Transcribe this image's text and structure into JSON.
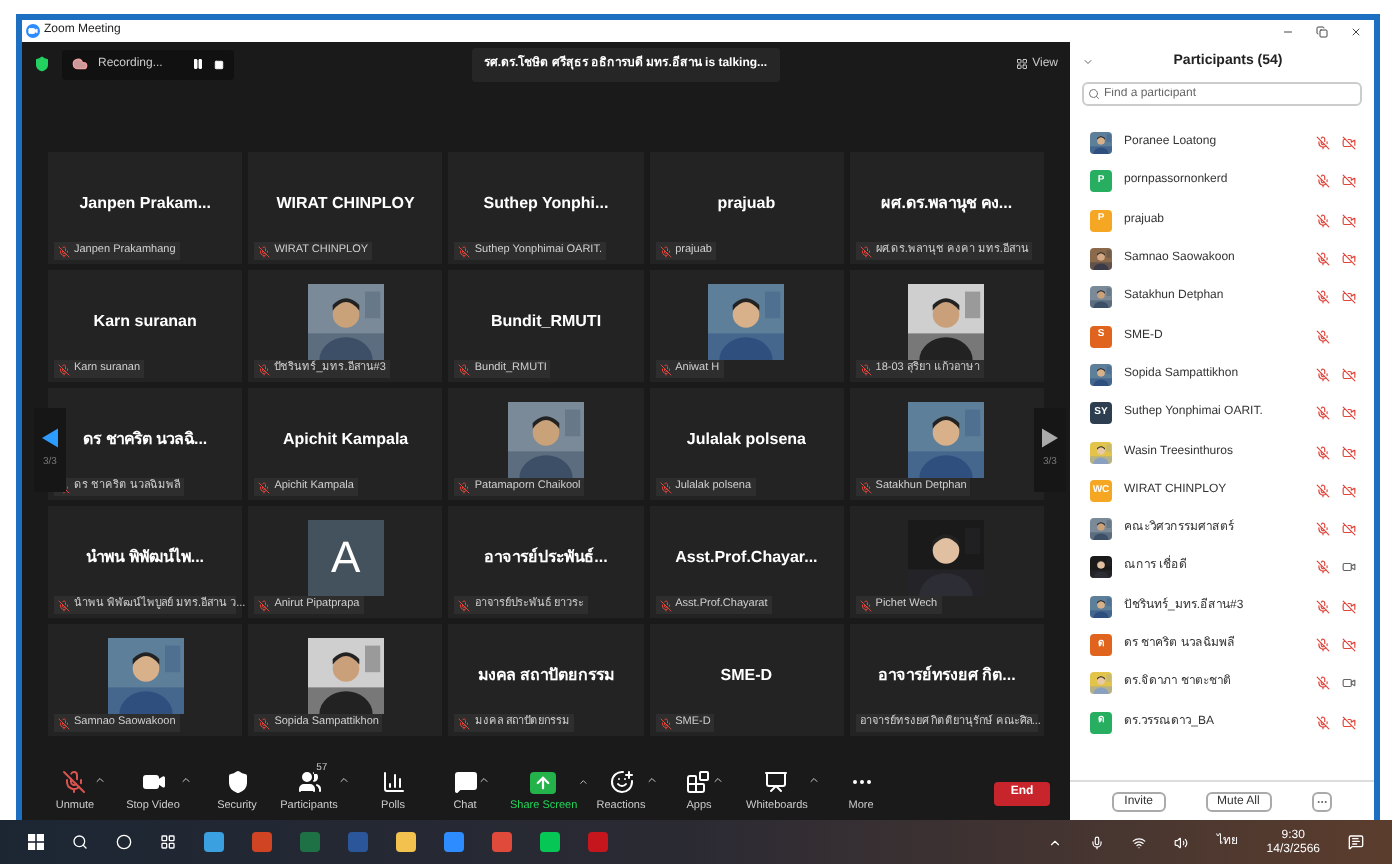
{
  "window": {
    "title": "Zoom Meeting"
  },
  "meeting": {
    "recording": "Recording...",
    "talking": "รศ.ดร.โชษิต ศรีสุธร อธิการบดี มทร.อีสาน is  talking...",
    "view": "View",
    "page_left": "3/3",
    "page_right": "3/3",
    "tiles": [
      {
        "kind": "name",
        "title": "Janpen  Prakam...",
        "label": "Janpen Prakamhang",
        "muted": true
      },
      {
        "kind": "name",
        "title": "WIRAT CHINPLOY",
        "label": "WIRAT CHINPLOY",
        "muted": true
      },
      {
        "kind": "name",
        "title": "Suthep  Yonphi...",
        "label": "Suthep Yonphimai OARIT.",
        "muted": true
      },
      {
        "kind": "name",
        "title": "prajuab",
        "label": "prajuab",
        "muted": true
      },
      {
        "kind": "name",
        "title": "ผศ.ดร.พลานุช คง...",
        "label": "ผศ.ดร.พลานุช คงคา มทร.อีสาน",
        "muted": true
      },
      {
        "kind": "name",
        "title": "Karn suranan",
        "label": "Karn suranan",
        "muted": true
      },
      {
        "kind": "picture",
        "label": "ปัชรินทร์_มทร.อีสาน#3",
        "muted": true
      },
      {
        "kind": "name",
        "title": "Bundit_RMUTI",
        "label": "Bundit_RMUTI",
        "muted": true
      },
      {
        "kind": "picture",
        "label": "Aniwat H",
        "muted": true
      },
      {
        "kind": "picture",
        "label": "18-03 สุริยา แก้วอาษา",
        "muted": true
      },
      {
        "kind": "name",
        "title": "ดร ชาคริต นวลฉิ...",
        "label": "ดร ชาคริต นวลฉิมพลี",
        "muted": true
      },
      {
        "kind": "name",
        "title": "Apichit Kampala",
        "label": "Apichit Kampala",
        "muted": true
      },
      {
        "kind": "picture",
        "label": "Patamaporn Chaikool",
        "muted": true
      },
      {
        "kind": "name",
        "title": "Julalak polsena",
        "label": "Julalak polsena",
        "muted": true
      },
      {
        "kind": "picture",
        "label": "Satakhun Detphan",
        "muted": true
      },
      {
        "kind": "name",
        "title": "นำพน พิพัฒน์ไพ...",
        "label": "นำพน พิพัฒน์ไพบูลย์ มทร.อีสาน ว...",
        "muted": true
      },
      {
        "kind": "avatar",
        "title": "A",
        "label": "Anirut Pipatprapa",
        "muted": true
      },
      {
        "kind": "name",
        "title": "อาจารย์ประพันธ์...",
        "label": "อาจารย์ประพันธ์ ยาวระ",
        "muted": true
      },
      {
        "kind": "name",
        "title": "Asst.Prof.Chayar...",
        "label": "Asst.Prof.Chayarat",
        "muted": true
      },
      {
        "kind": "picture",
        "label": "Pichet Wech",
        "muted": true
      },
      {
        "kind": "picture",
        "label": "Samnao Saowakoon",
        "muted": true
      },
      {
        "kind": "picture",
        "label": "Sopida Sampattikhon",
        "muted": true
      },
      {
        "kind": "name",
        "title": "มงคล สถาปัตยกรรม",
        "label": "มงคล สถาปัตยกรรม",
        "muted": true
      },
      {
        "kind": "name",
        "title": "SME-D",
        "label": "SME-D",
        "muted": true
      },
      {
        "kind": "name",
        "title": "อาจารย์ทรงยศ กิต...",
        "label": "อาจารย์ทรงยศ กิตติยานุรักษ์ คณะศิล...",
        "muted": false
      }
    ]
  },
  "toolbar": [
    {
      "kind": "unmute",
      "label": "Unmute",
      "caret": true
    },
    {
      "kind": "video",
      "label": "Stop Video",
      "caret": true
    },
    {
      "kind": "security",
      "label": "Security",
      "caret": false
    },
    {
      "kind": "participants",
      "label": "Participants",
      "badge": "57",
      "caret": true
    },
    {
      "kind": "polls",
      "label": "Polls",
      "caret": false
    },
    {
      "kind": "chat",
      "label": "Chat",
      "caret": true
    },
    {
      "kind": "share",
      "label": "Share Screen",
      "caret": true
    },
    {
      "kind": "reactions",
      "label": "Reactions",
      "caret": true
    },
    {
      "kind": "apps",
      "label": "Apps",
      "caret": true
    },
    {
      "kind": "whiteboards",
      "label": "Whiteboards",
      "caret": true
    },
    {
      "kind": "more",
      "label": "More",
      "caret": false
    }
  ],
  "end": "End",
  "panel": {
    "title": "Participants (54)",
    "search": {
      "placeholder": "Find a participant"
    },
    "participants": [
      {
        "name": "Poranee Loatong",
        "muted": true,
        "video_off": true
      },
      {
        "initial": "P",
        "color": "#27ae60",
        "name": "pornpassornonkerd",
        "muted": true,
        "video_off": true
      },
      {
        "initial": "P",
        "color": "#f5a623",
        "name": "prajuab",
        "muted": true,
        "video_off": true
      },
      {
        "name": "Samnao Saowakoon",
        "muted": true,
        "video_off": true
      },
      {
        "name": "Satakhun Detphan",
        "muted": true,
        "video_off": true
      },
      {
        "initial": "S",
        "color": "#e0641e",
        "name": "SME-D",
        "muted": true,
        "camera_hidden": true
      },
      {
        "name": "Sopida Sampattikhon",
        "muted": true,
        "video_off": true
      },
      {
        "initial": "SY",
        "color": "#2d3e50",
        "name": "Suthep Yonphimai OARIT.",
        "muted": true,
        "video_off": true
      },
      {
        "name": "Wasin Treesinthuros",
        "muted": true,
        "video_off": true
      },
      {
        "initial": "WC",
        "color": "#f5a623",
        "name": "WIRAT CHINPLOY",
        "muted": true,
        "video_off": true
      },
      {
        "name": "คณะวิศวกรรมศาสตร์",
        "muted": true,
        "video_off": true
      },
      {
        "name": "ณการ เชื่อดี",
        "muted": true,
        "video_off": false
      },
      {
        "name": "ปัชรินทร์_มทร.อีสาน#3",
        "muted": true,
        "video_off": true
      },
      {
        "initial": "ด",
        "color": "#e0641e",
        "name": "ดร ชาคริต นวลฉิมพลี",
        "muted": true,
        "video_off": true
      },
      {
        "name": "ดร.จิดาภา ชาตะชาติ",
        "muted": true,
        "video_off": false
      },
      {
        "initial": "ด",
        "color": "#27ae60",
        "name": "ดร.วรรณดาว_BA",
        "muted": true,
        "video_off": true
      }
    ],
    "buttons": [
      "Invite",
      "Mute All"
    ]
  },
  "taskbar": {
    "language": "ไทย",
    "time": "9:30",
    "date": "14/3/2566"
  }
}
